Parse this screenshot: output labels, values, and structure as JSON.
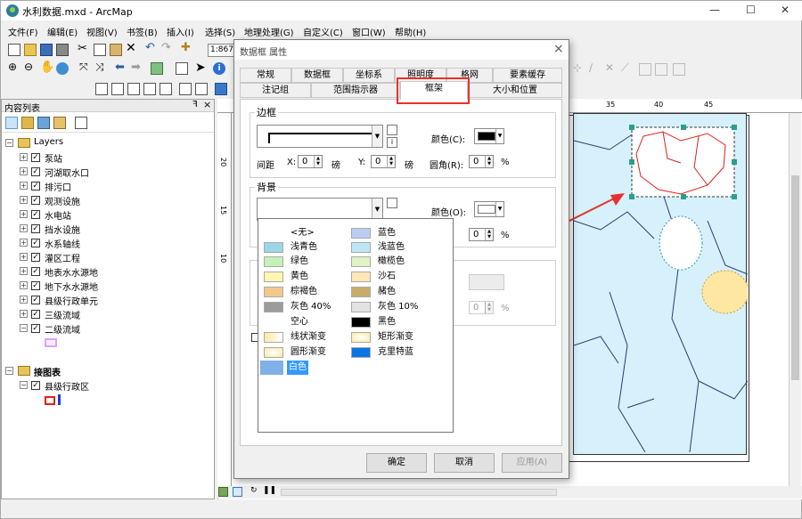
{
  "window": {
    "title": "水利数据.mxd - ArcMap",
    "min_icon": "—",
    "max_icon": "☐",
    "close_icon": "✕"
  },
  "menu": [
    "文件(F)",
    "编辑(E)",
    "视图(V)",
    "书签(B)",
    "插入(I)",
    "选择(S)",
    "地理处理(G)",
    "自定义(C)",
    "窗口(W)",
    "帮助(H)"
  ],
  "toolbar": {
    "scale": "1:867,"
  },
  "toc": {
    "title": "内容列表",
    "pin": "ꟻ",
    "close": "×",
    "layers_label": "Layers",
    "layers": [
      "泵站",
      "河湖取水口",
      "排污口",
      "观测设施",
      "水电站",
      "挡水设施",
      "水系轴线",
      "灌区工程",
      "地表水水源地",
      "地下水水源地",
      "县级行政单元",
      "三级流域",
      "二级流域"
    ],
    "group2_label": "接图表",
    "group2_layers": [
      "县级行政区"
    ]
  },
  "ruler": {
    "top": [
      "35",
      "40",
      "45"
    ],
    "left": [
      "20",
      "15",
      "10"
    ]
  },
  "dialog": {
    "title": "数据框 属性",
    "close": "×",
    "tabs_row1": [
      "常规",
      "数据框",
      "坐标系",
      "照明度",
      "格网",
      "要素缓存"
    ],
    "tabs_row2": [
      "注记组",
      "范围指示器",
      "框架",
      "大小和位置"
    ],
    "active_tab": "框架",
    "border": {
      "group": "边框",
      "color_label": "颜色(C):",
      "color": "#000000",
      "spacing_label": "间距",
      "x_label": "X:",
      "x_value": "0",
      "x_unit": "磅",
      "y_label": "Y:",
      "y_value": "0",
      "y_unit": "磅",
      "round_label": "圆角(R):",
      "round_value": "0",
      "round_unit": "%"
    },
    "background": {
      "group": "背景",
      "color_label": "颜色(O):",
      "color": "#ffffff",
      "round_value": "0",
      "round_unit": "%"
    },
    "shadow": {
      "round_value": "0",
      "round_unit": "%"
    },
    "buttons": {
      "ok": "确定",
      "cancel": "取消",
      "apply": "应用(A)"
    }
  },
  "dropdown": {
    "left": [
      {
        "name": "<无>",
        "color": ""
      },
      {
        "name": "浅青色",
        "color": "#9bd6ea"
      },
      {
        "name": "绿色",
        "color": "#c5f1b8"
      },
      {
        "name": "黄色",
        "color": "#fff6b1"
      },
      {
        "name": "棕褐色",
        "color": "#f3c88a"
      },
      {
        "name": "灰色 40%",
        "color": "#9c9c9c"
      },
      {
        "name": "空心",
        "color": ""
      },
      {
        "name": "线状渐变",
        "color": "#fde9a6"
      },
      {
        "name": "圆形渐变",
        "color": "#fde9a6"
      },
      {
        "name": "白色",
        "color": "#ffffff"
      }
    ],
    "right": [
      {
        "name": "蓝色",
        "color": "#bccdf5"
      },
      {
        "name": "浅蓝色",
        "color": "#bde7f7"
      },
      {
        "name": "橄榄色",
        "color": "#e0f3c2"
      },
      {
        "name": "沙石",
        "color": "#fde7b6"
      },
      {
        "name": "赭色",
        "color": "#c9ab6c"
      },
      {
        "name": "灰色 10%",
        "color": "#e3e3e3"
      },
      {
        "name": "黑色",
        "color": "#000000"
      },
      {
        "name": "矩形渐变",
        "color": "#fde9a6"
      },
      {
        "name": "克里特蓝",
        "color": "#0a74e6"
      }
    ],
    "selected": "白色"
  },
  "accent": {
    "highlight": "#e8312f",
    "selection_blue": "#3399ff"
  }
}
